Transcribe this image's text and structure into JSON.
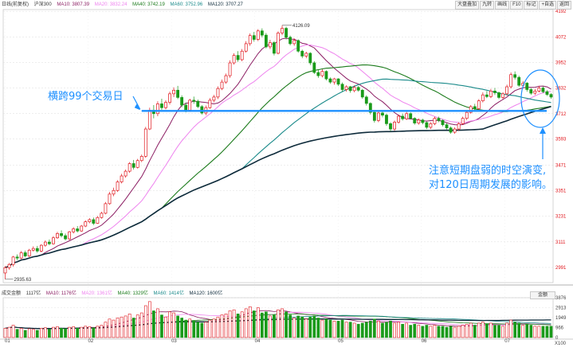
{
  "legend": {
    "name": "日线(前复权)",
    "index": "沪深300",
    "ma10": "MA10: 3807.39",
    "ma20": "MA20: 3832.24",
    "ma40": "MA40: 3742.19",
    "ma60": "MA60: 3752.96",
    "ma120": "MA120: 3707.27"
  },
  "toolbar": [
    "大盘叠加",
    "九转",
    "画线",
    "F10",
    "标记",
    "+自选",
    "返回"
  ],
  "volume_legend": {
    "name": "成交金额",
    "v": "1117亿",
    "ma10": "MA10: 1176亿",
    "ma20": "MA20: 1361亿",
    "ma40": "MA40: 1329亿",
    "ma60": "MA60: 1414亿",
    "ma120": "MA120: 1600亿"
  },
  "volume_button": "金额",
  "annotations": {
    "left": "横跨99个交易日",
    "right_line1": "注意短期盘弱的时空演变,",
    "right_line2": "对120日周期发展的影响。",
    "high_label": "4126.09",
    "low_label": "2935.63"
  },
  "colors": {
    "up": "#e0151b",
    "down": "#1a9a1a",
    "ma10": "#8b1c62",
    "ma20": "#ee82ee",
    "ma40": "#1a7a1a",
    "ma60": "#1a8a8a",
    "ma120": "#0d2a3a",
    "annotation": "#1e90ff"
  },
  "chart_data": {
    "type": "candlestick",
    "price_axis": {
      "ticks": [
        2991,
        3111,
        3231,
        3351,
        3471,
        3593,
        3712,
        3832,
        3952,
        4072,
        4192
      ],
      "ylim": [
        2920,
        4200
      ]
    },
    "volume_axis": {
      "ticks": [
        0,
        966,
        1949,
        2913,
        3876
      ],
      "unit": "X100"
    },
    "x_ticks": [
      "01",
      "02",
      "03",
      "04",
      "05",
      "06",
      "07"
    ],
    "support_level": 3725,
    "high": 4126.09,
    "low": 2935.63,
    "candles": [
      {
        "o": 2965,
        "c": 2990,
        "h": 2998,
        "l": 2936,
        "v": 900
      },
      {
        "o": 2990,
        "c": 3005,
        "h": 3012,
        "l": 2980,
        "v": 1000
      },
      {
        "o": 3005,
        "c": 3040,
        "h": 3045,
        "l": 2995,
        "v": 1200
      },
      {
        "o": 3040,
        "c": 3035,
        "h": 3052,
        "l": 3025,
        "v": 800
      },
      {
        "o": 3035,
        "c": 3060,
        "h": 3068,
        "l": 3030,
        "v": 900
      },
      {
        "o": 3060,
        "c": 3045,
        "h": 3070,
        "l": 3038,
        "v": 700
      },
      {
        "o": 3045,
        "c": 3072,
        "h": 3078,
        "l": 3040,
        "v": 850
      },
      {
        "o": 3072,
        "c": 3080,
        "h": 3090,
        "l": 3065,
        "v": 800
      },
      {
        "o": 3080,
        "c": 3068,
        "h": 3092,
        "l": 3060,
        "v": 700
      },
      {
        "o": 3068,
        "c": 3095,
        "h": 3100,
        "l": 3062,
        "v": 900
      },
      {
        "o": 3095,
        "c": 3110,
        "h": 3118,
        "l": 3088,
        "v": 950
      },
      {
        "o": 3110,
        "c": 3102,
        "h": 3122,
        "l": 3095,
        "v": 800
      },
      {
        "o": 3102,
        "c": 3130,
        "h": 3138,
        "l": 3098,
        "v": 1000
      },
      {
        "o": 3130,
        "c": 3150,
        "h": 3158,
        "l": 3125,
        "v": 1050
      },
      {
        "o": 3150,
        "c": 3140,
        "h": 3165,
        "l": 3132,
        "v": 900
      },
      {
        "o": 3140,
        "c": 3125,
        "h": 3150,
        "l": 3118,
        "v": 850
      },
      {
        "o": 3125,
        "c": 3158,
        "h": 3162,
        "l": 3120,
        "v": 1000
      },
      {
        "o": 3158,
        "c": 3172,
        "h": 3180,
        "l": 3150,
        "v": 1050
      },
      {
        "o": 3172,
        "c": 3162,
        "h": 3185,
        "l": 3155,
        "v": 900
      },
      {
        "o": 3162,
        "c": 3185,
        "h": 3190,
        "l": 3158,
        "v": 1000
      },
      {
        "o": 3185,
        "c": 3205,
        "h": 3212,
        "l": 3180,
        "v": 1100
      },
      {
        "o": 3205,
        "c": 3215,
        "h": 3222,
        "l": 3198,
        "v": 1050
      },
      {
        "o": 3215,
        "c": 3198,
        "h": 3225,
        "l": 3190,
        "v": 950
      },
      {
        "o": 3198,
        "c": 3225,
        "h": 3232,
        "l": 3195,
        "v": 1100
      },
      {
        "o": 3225,
        "c": 3245,
        "h": 3252,
        "l": 3220,
        "v": 1200
      },
      {
        "o": 3245,
        "c": 3290,
        "h": 3298,
        "l": 3240,
        "v": 1500
      },
      {
        "o": 3290,
        "c": 3335,
        "h": 3345,
        "l": 3285,
        "v": 1800
      },
      {
        "o": 3335,
        "c": 3352,
        "h": 3365,
        "l": 3325,
        "v": 1700
      },
      {
        "o": 3352,
        "c": 3392,
        "h": 3400,
        "l": 3345,
        "v": 1900
      },
      {
        "o": 3392,
        "c": 3420,
        "h": 3430,
        "l": 3385,
        "v": 2000
      },
      {
        "o": 3420,
        "c": 3442,
        "h": 3450,
        "l": 3412,
        "v": 2100
      },
      {
        "o": 3442,
        "c": 3478,
        "h": 3485,
        "l": 3435,
        "v": 2300
      },
      {
        "o": 3478,
        "c": 3460,
        "h": 3495,
        "l": 3450,
        "v": 1900
      },
      {
        "o": 3460,
        "c": 3492,
        "h": 3500,
        "l": 3455,
        "v": 2200
      },
      {
        "o": 3492,
        "c": 3512,
        "h": 3520,
        "l": 3485,
        "v": 2400
      },
      {
        "o": 3512,
        "c": 3640,
        "h": 3650,
        "l": 3505,
        "v": 3100
      },
      {
        "o": 3640,
        "c": 3728,
        "h": 3740,
        "l": 3635,
        "v": 3500
      },
      {
        "o": 3728,
        "c": 3712,
        "h": 3752,
        "l": 3690,
        "v": 2600
      },
      {
        "o": 3712,
        "c": 3758,
        "h": 3770,
        "l": 3700,
        "v": 2800
      },
      {
        "o": 3758,
        "c": 3740,
        "h": 3782,
        "l": 3730,
        "v": 2200
      },
      {
        "o": 3740,
        "c": 3765,
        "h": 3775,
        "l": 3732,
        "v": 2000
      },
      {
        "o": 3765,
        "c": 3805,
        "h": 3815,
        "l": 3755,
        "v": 2500
      },
      {
        "o": 3805,
        "c": 3822,
        "h": 3835,
        "l": 3790,
        "v": 2400
      },
      {
        "o": 3822,
        "c": 3788,
        "h": 3842,
        "l": 3780,
        "v": 2100
      },
      {
        "o": 3788,
        "c": 3752,
        "h": 3798,
        "l": 3742,
        "v": 1900
      },
      {
        "o": 3752,
        "c": 3728,
        "h": 3765,
        "l": 3718,
        "v": 1700
      },
      {
        "o": 3728,
        "c": 3775,
        "h": 3782,
        "l": 3720,
        "v": 1800
      },
      {
        "o": 3775,
        "c": 3770,
        "h": 3792,
        "l": 3758,
        "v": 1600
      },
      {
        "o": 3770,
        "c": 3745,
        "h": 3778,
        "l": 3738,
        "v": 1500
      },
      {
        "o": 3745,
        "c": 3715,
        "h": 3752,
        "l": 3708,
        "v": 1400
      },
      {
        "o": 3715,
        "c": 3740,
        "h": 3750,
        "l": 3705,
        "v": 1500
      },
      {
        "o": 3740,
        "c": 3775,
        "h": 3785,
        "l": 3735,
        "v": 1700
      },
      {
        "o": 3775,
        "c": 3790,
        "h": 3800,
        "l": 3765,
        "v": 1800
      },
      {
        "o": 3790,
        "c": 3830,
        "h": 3840,
        "l": 3780,
        "v": 2000
      },
      {
        "o": 3830,
        "c": 3860,
        "h": 3872,
        "l": 3822,
        "v": 2200
      },
      {
        "o": 3860,
        "c": 3890,
        "h": 3900,
        "l": 3852,
        "v": 2300
      },
      {
        "o": 3890,
        "c": 3950,
        "h": 3962,
        "l": 3880,
        "v": 2600
      },
      {
        "o": 3950,
        "c": 3985,
        "h": 3995,
        "l": 3942,
        "v": 2700
      },
      {
        "o": 3985,
        "c": 3965,
        "h": 4005,
        "l": 3955,
        "v": 2300
      },
      {
        "o": 3965,
        "c": 4005,
        "h": 4015,
        "l": 3958,
        "v": 2500
      },
      {
        "o": 4005,
        "c": 4040,
        "h": 4052,
        "l": 3998,
        "v": 2800
      },
      {
        "o": 4040,
        "c": 4078,
        "h": 4088,
        "l": 4030,
        "v": 3000
      },
      {
        "o": 4078,
        "c": 4060,
        "h": 4095,
        "l": 4050,
        "v": 2600
      },
      {
        "o": 4060,
        "c": 4100,
        "h": 4108,
        "l": 4052,
        "v": 2900
      },
      {
        "o": 4100,
        "c": 4080,
        "h": 4112,
        "l": 4070,
        "v": 2400
      },
      {
        "o": 4080,
        "c": 4025,
        "h": 4090,
        "l": 4018,
        "v": 2500
      },
      {
        "o": 4025,
        "c": 4045,
        "h": 4058,
        "l": 4015,
        "v": 2100
      },
      {
        "o": 4045,
        "c": 3995,
        "h": 4052,
        "l": 3985,
        "v": 2200
      },
      {
        "o": 3995,
        "c": 4090,
        "h": 4098,
        "l": 3990,
        "v": 2700
      },
      {
        "o": 4090,
        "c": 4112,
        "h": 4126,
        "l": 4080,
        "v": 2800
      },
      {
        "o": 4112,
        "c": 4070,
        "h": 4120,
        "l": 4060,
        "v": 2500
      },
      {
        "o": 4070,
        "c": 4040,
        "h": 4078,
        "l": 4032,
        "v": 2200
      },
      {
        "o": 4040,
        "c": 4055,
        "h": 4065,
        "l": 4030,
        "v": 1900
      },
      {
        "o": 4055,
        "c": 4005,
        "h": 4060,
        "l": 3998,
        "v": 2100
      },
      {
        "o": 4005,
        "c": 3982,
        "h": 4012,
        "l": 3972,
        "v": 2000
      },
      {
        "o": 3982,
        "c": 3995,
        "h": 4002,
        "l": 3972,
        "v": 1800
      },
      {
        "o": 3995,
        "c": 3950,
        "h": 4000,
        "l": 3940,
        "v": 2000
      },
      {
        "o": 3950,
        "c": 3905,
        "h": 3958,
        "l": 3898,
        "v": 2100
      },
      {
        "o": 3905,
        "c": 3890,
        "h": 3918,
        "l": 3880,
        "v": 1900
      },
      {
        "o": 3890,
        "c": 3910,
        "h": 3920,
        "l": 3882,
        "v": 1700
      },
      {
        "o": 3910,
        "c": 3875,
        "h": 3915,
        "l": 3868,
        "v": 1800
      },
      {
        "o": 3875,
        "c": 3860,
        "h": 3882,
        "l": 3852,
        "v": 1700
      },
      {
        "o": 3860,
        "c": 3875,
        "h": 3880,
        "l": 3848,
        "v": 1600
      },
      {
        "o": 3875,
        "c": 3850,
        "h": 3878,
        "l": 3842,
        "v": 1600
      },
      {
        "o": 3850,
        "c": 3825,
        "h": 3858,
        "l": 3815,
        "v": 1700
      },
      {
        "o": 3825,
        "c": 3838,
        "h": 3845,
        "l": 3815,
        "v": 1500
      },
      {
        "o": 3838,
        "c": 3820,
        "h": 3842,
        "l": 3810,
        "v": 1500
      },
      {
        "o": 3820,
        "c": 3835,
        "h": 3845,
        "l": 3812,
        "v": 1400
      },
      {
        "o": 3835,
        "c": 3822,
        "h": 3842,
        "l": 3815,
        "v": 1300
      },
      {
        "o": 3822,
        "c": 3790,
        "h": 3828,
        "l": 3782,
        "v": 1400
      },
      {
        "o": 3790,
        "c": 3760,
        "h": 3798,
        "l": 3750,
        "v": 1500
      },
      {
        "o": 3760,
        "c": 3718,
        "h": 3765,
        "l": 3708,
        "v": 1600
      },
      {
        "o": 3718,
        "c": 3680,
        "h": 3725,
        "l": 3670,
        "v": 1800
      },
      {
        "o": 3680,
        "c": 3715,
        "h": 3722,
        "l": 3672,
        "v": 1600
      },
      {
        "o": 3715,
        "c": 3705,
        "h": 3722,
        "l": 3695,
        "v": 1400
      },
      {
        "o": 3705,
        "c": 3665,
        "h": 3712,
        "l": 3655,
        "v": 1500
      },
      {
        "o": 3665,
        "c": 3640,
        "h": 3672,
        "l": 3630,
        "v": 1600
      },
      {
        "o": 3640,
        "c": 3672,
        "h": 3680,
        "l": 3632,
        "v": 1400
      },
      {
        "o": 3672,
        "c": 3700,
        "h": 3708,
        "l": 3665,
        "v": 1500
      },
      {
        "o": 3700,
        "c": 3688,
        "h": 3712,
        "l": 3680,
        "v": 1300
      },
      {
        "o": 3688,
        "c": 3712,
        "h": 3720,
        "l": 3682,
        "v": 1400
      },
      {
        "o": 3712,
        "c": 3690,
        "h": 3718,
        "l": 3685,
        "v": 1200
      },
      {
        "o": 3690,
        "c": 3668,
        "h": 3695,
        "l": 3660,
        "v": 1300
      },
      {
        "o": 3668,
        "c": 3682,
        "h": 3690,
        "l": 3660,
        "v": 1200
      },
      {
        "o": 3682,
        "c": 3670,
        "h": 3688,
        "l": 3662,
        "v": 1100
      },
      {
        "o": 3670,
        "c": 3648,
        "h": 3675,
        "l": 3640,
        "v": 1200
      },
      {
        "o": 3648,
        "c": 3665,
        "h": 3672,
        "l": 3640,
        "v": 1100
      },
      {
        "o": 3665,
        "c": 3690,
        "h": 3698,
        "l": 3658,
        "v": 1200
      },
      {
        "o": 3690,
        "c": 3680,
        "h": 3698,
        "l": 3672,
        "v": 1100
      },
      {
        "o": 3680,
        "c": 3660,
        "h": 3686,
        "l": 3652,
        "v": 1100
      },
      {
        "o": 3660,
        "c": 3645,
        "h": 3668,
        "l": 3638,
        "v": 1000
      },
      {
        "o": 3645,
        "c": 3625,
        "h": 3652,
        "l": 3618,
        "v": 1100
      },
      {
        "o": 3625,
        "c": 3640,
        "h": 3648,
        "l": 3618,
        "v": 1000
      },
      {
        "o": 3640,
        "c": 3665,
        "h": 3672,
        "l": 3632,
        "v": 1100
      },
      {
        "o": 3665,
        "c": 3690,
        "h": 3698,
        "l": 3660,
        "v": 1200
      },
      {
        "o": 3690,
        "c": 3718,
        "h": 3725,
        "l": 3682,
        "v": 1300
      },
      {
        "o": 3718,
        "c": 3745,
        "h": 3752,
        "l": 3712,
        "v": 1400
      },
      {
        "o": 3745,
        "c": 3735,
        "h": 3758,
        "l": 3728,
        "v": 1200
      },
      {
        "o": 3735,
        "c": 3772,
        "h": 3780,
        "l": 3730,
        "v": 1400
      },
      {
        "o": 3772,
        "c": 3800,
        "h": 3812,
        "l": 3765,
        "v": 1500
      },
      {
        "o": 3800,
        "c": 3792,
        "h": 3818,
        "l": 3785,
        "v": 1300
      },
      {
        "o": 3792,
        "c": 3818,
        "h": 3828,
        "l": 3785,
        "v": 1400
      },
      {
        "o": 3818,
        "c": 3810,
        "h": 3832,
        "l": 3800,
        "v": 1200
      },
      {
        "o": 3810,
        "c": 3788,
        "h": 3815,
        "l": 3780,
        "v": 1200
      },
      {
        "o": 3788,
        "c": 3805,
        "h": 3812,
        "l": 3780,
        "v": 1100
      },
      {
        "o": 3805,
        "c": 3838,
        "h": 3848,
        "l": 3798,
        "v": 1400
      },
      {
        "o": 3838,
        "c": 3895,
        "h": 3905,
        "l": 3830,
        "v": 1700
      },
      {
        "o": 3895,
        "c": 3882,
        "h": 3910,
        "l": 3872,
        "v": 1500
      },
      {
        "o": 3882,
        "c": 3845,
        "h": 3890,
        "l": 3838,
        "v": 1400
      },
      {
        "o": 3845,
        "c": 3855,
        "h": 3865,
        "l": 3838,
        "v": 1200
      },
      {
        "o": 3855,
        "c": 3825,
        "h": 3860,
        "l": 3815,
        "v": 1300
      },
      {
        "o": 3825,
        "c": 3808,
        "h": 3832,
        "l": 3800,
        "v": 1200
      },
      {
        "o": 3808,
        "c": 3818,
        "h": 3828,
        "l": 3800,
        "v": 1100
      },
      {
        "o": 3818,
        "c": 3832,
        "h": 3842,
        "l": 3812,
        "v": 1100
      },
      {
        "o": 3832,
        "c": 3815,
        "h": 3840,
        "l": 3808,
        "v": 1100
      },
      {
        "o": 3815,
        "c": 3802,
        "h": 3822,
        "l": 3795,
        "v": 1100
      },
      {
        "o": 3802,
        "c": 3790,
        "h": 3808,
        "l": 3782,
        "v": 1100
      }
    ],
    "ma_series": [
      {
        "name": "MA10",
        "period": 10
      },
      {
        "name": "MA20",
        "period": 20
      },
      {
        "name": "MA40",
        "period": 40
      },
      {
        "name": "MA60",
        "period": 60
      },
      {
        "name": "MA120",
        "period": 120
      }
    ]
  }
}
